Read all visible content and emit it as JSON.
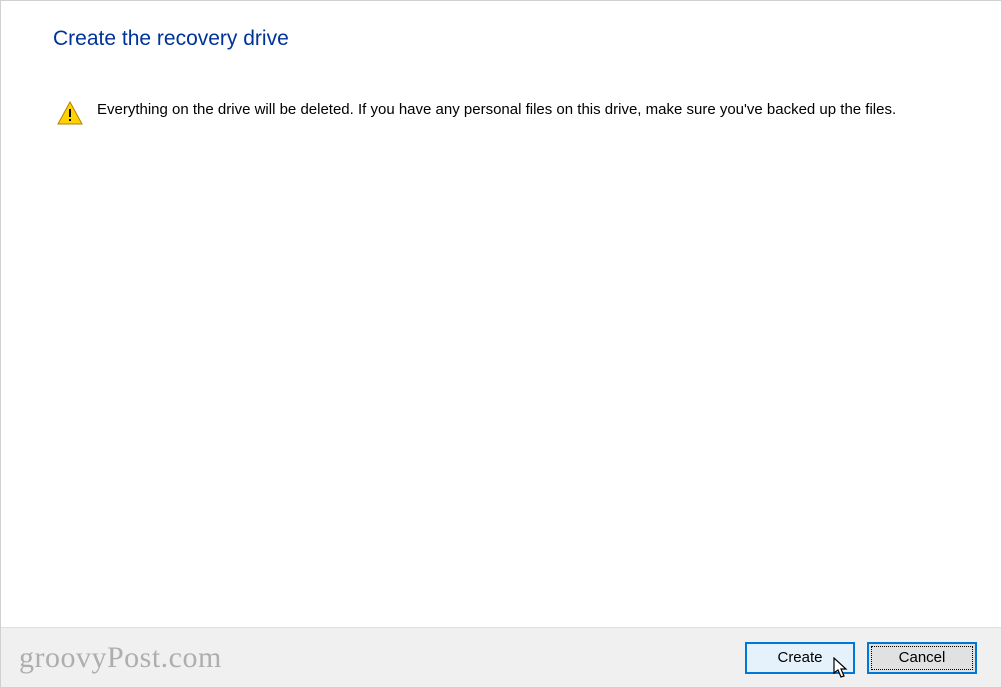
{
  "header": {
    "title": "Create the recovery drive"
  },
  "warning": {
    "message": "Everything on the drive will be deleted. If you have any personal files on this drive, make sure you've backed up the files."
  },
  "buttons": {
    "create_label": "Create",
    "cancel_label": "Cancel"
  },
  "watermark": {
    "text": "groovyPost.com"
  }
}
